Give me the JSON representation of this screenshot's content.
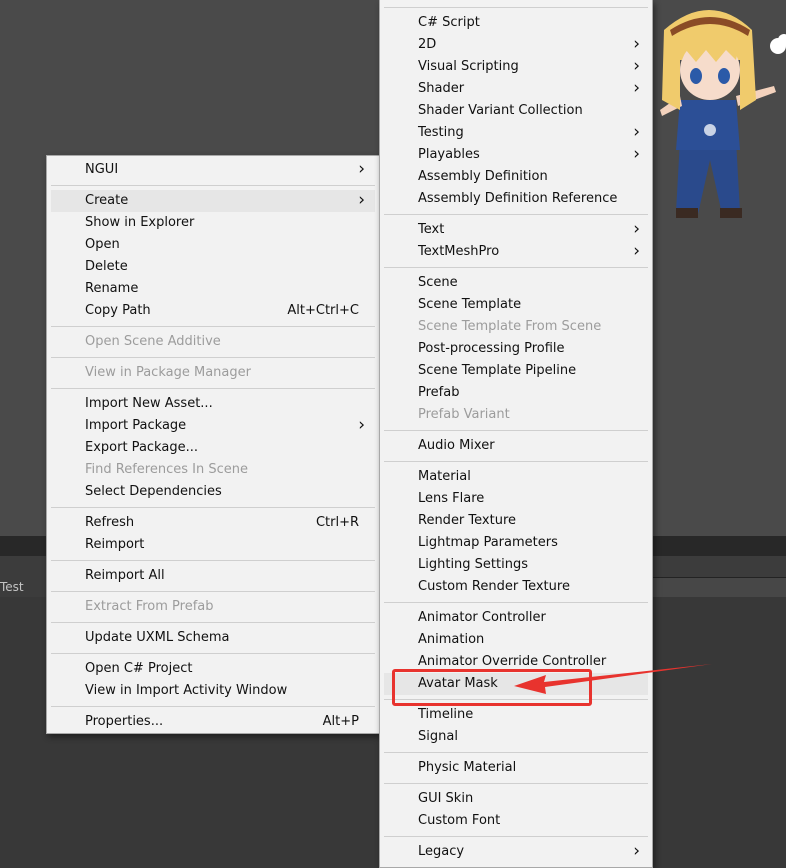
{
  "status_tab": "Test",
  "context_menu": {
    "items": [
      {
        "label": "NGUI",
        "submenu": true
      },
      {
        "label": "Create",
        "submenu": true,
        "highlighted": true
      },
      {
        "label": "Show in Explorer"
      },
      {
        "label": "Open"
      },
      {
        "label": "Delete"
      },
      {
        "label": "Rename"
      },
      {
        "label": "Copy Path",
        "shortcut": "Alt+Ctrl+C"
      },
      {
        "label": "Open Scene Additive",
        "disabled": true
      },
      {
        "label": "View in Package Manager",
        "disabled": true
      },
      {
        "label": "Import New Asset..."
      },
      {
        "label": "Import Package",
        "submenu": true
      },
      {
        "label": "Export Package..."
      },
      {
        "label": "Find References In Scene",
        "disabled": true
      },
      {
        "label": "Select Dependencies"
      },
      {
        "label": "Refresh",
        "shortcut": "Ctrl+R"
      },
      {
        "label": "Reimport"
      },
      {
        "label": "Reimport All"
      },
      {
        "label": "Extract From Prefab",
        "disabled": true
      },
      {
        "label": "Update UXML Schema"
      },
      {
        "label": "Open C# Project"
      },
      {
        "label": "View in Import Activity Window"
      },
      {
        "label": "Properties...",
        "shortcut": "Alt+P"
      }
    ]
  },
  "create_submenu": {
    "items": [
      {
        "label": "C# Script"
      },
      {
        "label": "2D",
        "submenu": true
      },
      {
        "label": "Visual Scripting",
        "submenu": true
      },
      {
        "label": "Shader",
        "submenu": true
      },
      {
        "label": "Shader Variant Collection"
      },
      {
        "label": "Testing",
        "submenu": true
      },
      {
        "label": "Playables",
        "submenu": true
      },
      {
        "label": "Assembly Definition"
      },
      {
        "label": "Assembly Definition Reference"
      },
      {
        "label": "Text",
        "submenu": true
      },
      {
        "label": "TextMeshPro",
        "submenu": true
      },
      {
        "label": "Scene"
      },
      {
        "label": "Scene Template"
      },
      {
        "label": "Scene Template From Scene",
        "disabled": true
      },
      {
        "label": "Post-processing Profile"
      },
      {
        "label": "Scene Template Pipeline"
      },
      {
        "label": "Prefab"
      },
      {
        "label": "Prefab Variant",
        "disabled": true
      },
      {
        "label": "Audio Mixer"
      },
      {
        "label": "Material"
      },
      {
        "label": "Lens Flare"
      },
      {
        "label": "Render Texture"
      },
      {
        "label": "Lightmap Parameters"
      },
      {
        "label": "Lighting Settings"
      },
      {
        "label": "Custom Render Texture"
      },
      {
        "label": "Animator Controller"
      },
      {
        "label": "Animation"
      },
      {
        "label": "Animator Override Controller"
      },
      {
        "label": "Avatar Mask",
        "highlighted": true
      },
      {
        "label": "Timeline"
      },
      {
        "label": "Signal"
      },
      {
        "label": "Physic Material"
      },
      {
        "label": "GUI Skin"
      },
      {
        "label": "Custom Font"
      },
      {
        "label": "Legacy",
        "submenu": true
      }
    ]
  },
  "colors": {
    "annotation": "#e8332e",
    "menu_bg": "#f2f2f2",
    "disabled_text": "#9c9c9c"
  }
}
